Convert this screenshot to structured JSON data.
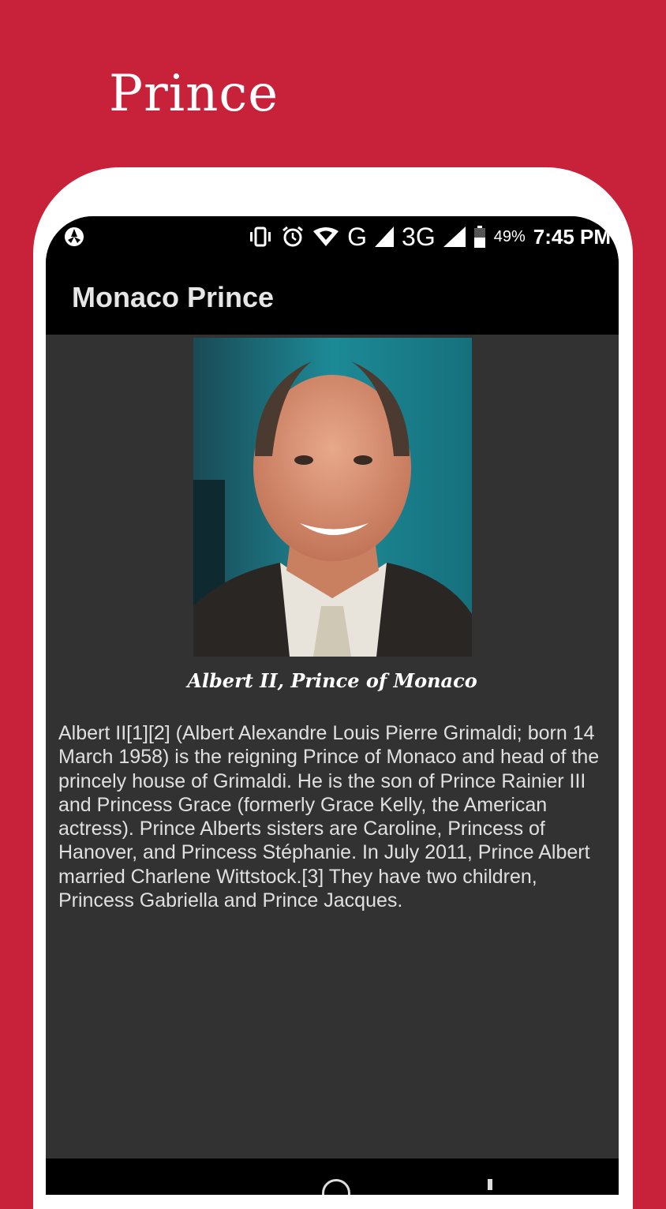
{
  "promo": {
    "title": "Prince"
  },
  "status_bar": {
    "battery": "49%",
    "time": "7:45 PM",
    "network_1": "G",
    "network_2": "3G",
    "icons": [
      "camera-aperture-icon",
      "vibrate-icon",
      "alarm-icon",
      "wifi-icon",
      "signal-icon",
      "signal-icon",
      "battery-icon"
    ]
  },
  "app_bar": {
    "title": "Monaco Prince"
  },
  "content": {
    "image": {
      "description_icon": "portrait-photo"
    },
    "caption": "Albert II, Prince of Monaco",
    "bio": "Albert II[1][2] (Albert Alexandre Louis Pierre Grimaldi; born 14 March 1958) is the reigning Prince of Monaco and head of the princely house of Grimaldi. He is the son of Prince Rainier III and Princess Grace (formerly Grace Kelly, the American actress). Prince Alberts sisters are Caroline, Princess of Hanover, and Princess Stéphanie. In July 2011, Prince Albert married Charlene Wittstock.[3] They have two children, Princess Gabriella and Prince Jacques."
  },
  "colors": {
    "background": "#c8223a",
    "frame": "#ffffff",
    "screen": "#323232",
    "bar": "#000000"
  }
}
